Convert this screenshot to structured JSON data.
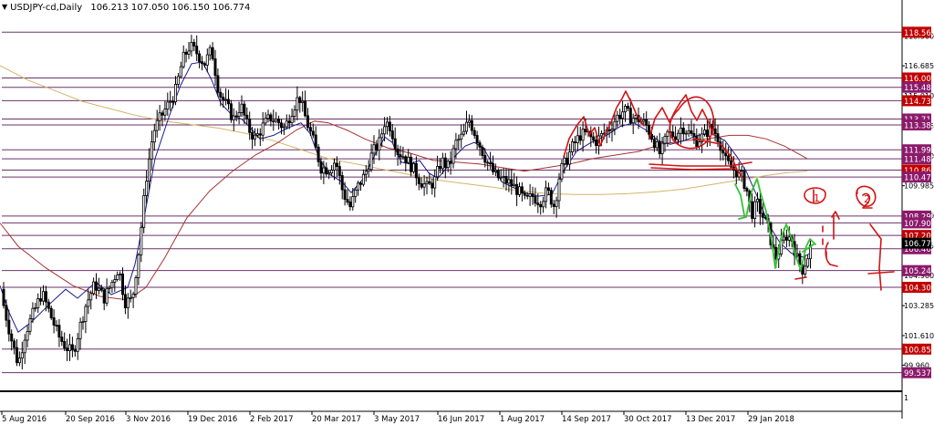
{
  "header": {
    "symbol": "USDJPY-cd,Daily",
    "open": "106.213",
    "high": "107.050",
    "low": "106.150",
    "close": "106.774"
  },
  "chart_data": {
    "type": "candlestick",
    "ylim": [
      98.5,
      119.7
    ],
    "y_ticks": [
      "118.360",
      "116.685",
      "115.010",
      "113.335",
      "111.660",
      "109.985",
      "108.310",
      "106.635",
      "104.960",
      "103.285",
      "101.610",
      "99.960"
    ],
    "x_ticks": [
      "5 Aug 2016",
      "20 Sep 2016",
      "3 Nov 2016",
      "19 Dec 2016",
      "2 Feb 2017",
      "20 Mar 2017",
      "3 May 2017",
      "16 Jun 2017",
      "1 Aug 2017",
      "14 Sep 2017",
      "30 Oct 2017",
      "13 Dec 2017",
      "29 Jan 2018"
    ],
    "price_levels": [
      {
        "label": "118.563",
        "value": 118.563,
        "color": "#c00000"
      },
      {
        "label": "116.006",
        "value": 116.006,
        "color": "#c00000"
      },
      {
        "label": "115.485",
        "value": 115.485,
        "color": "#8b1a6b"
      },
      {
        "label": "114.735",
        "value": 114.735,
        "color": "#c00000"
      },
      {
        "label": "113.714",
        "value": 113.714,
        "color": "#8b1a6b"
      },
      {
        "label": "113.382",
        "value": 113.382,
        "color": "#8b1a6b"
      },
      {
        "label": "111.993",
        "value": 111.993,
        "color": "#8b1a6b"
      },
      {
        "label": "111.489",
        "value": 111.489,
        "color": "#8b1a6b"
      },
      {
        "label": "110.861",
        "value": 110.861,
        "color": "#c00000"
      },
      {
        "label": "110.472",
        "value": 110.472,
        "color": "#8b1a6b"
      },
      {
        "label": "108.290",
        "value": 108.29,
        "color": "#8b1a6b"
      },
      {
        "label": "107.908",
        "value": 107.908,
        "color": "#8b1a6b"
      },
      {
        "label": "107.207",
        "value": 107.207,
        "color": "#c00000"
      },
      {
        "label": "106.463",
        "value": 106.463,
        "color": "#8b1a6b"
      },
      {
        "label": "105.244",
        "value": 105.244,
        "color": "#8b1a6b"
      },
      {
        "label": "104.307",
        "value": 104.307,
        "color": "#c00000"
      },
      {
        "label": "100.855",
        "value": 100.855,
        "color": "#c00000"
      },
      {
        "label": "99.537",
        "value": 99.537,
        "color": "#8b1a6b"
      }
    ],
    "current_price": {
      "label": "106.774",
      "value": 106.774,
      "color": "#000000"
    },
    "ma_fast": [
      [
        0,
        104.4
      ],
      [
        10,
        102.9
      ],
      [
        20,
        101.8
      ],
      [
        35,
        102.4
      ],
      [
        55,
        103.4
      ],
      [
        72,
        104.2
      ],
      [
        85,
        103.7
      ],
      [
        105,
        104.6
      ],
      [
        122,
        103.9
      ],
      [
        140,
        104.3
      ],
      [
        148,
        105.6
      ],
      [
        158,
        108.2
      ],
      [
        170,
        111.5
      ],
      [
        185,
        113.8
      ],
      [
        198,
        115.6
      ],
      [
        210,
        116.8
      ],
      [
        222,
        116.9
      ],
      [
        232,
        115.9
      ],
      [
        242,
        114.6
      ],
      [
        255,
        113.9
      ],
      [
        265,
        113.7
      ],
      [
        275,
        113.2
      ],
      [
        285,
        112.6
      ],
      [
        300,
        112.8
      ],
      [
        315,
        113.2
      ],
      [
        330,
        113.5
      ],
      [
        340,
        112.9
      ],
      [
        350,
        111.5
      ],
      [
        362,
        110.6
      ],
      [
        375,
        110.2
      ],
      [
        385,
        109.6
      ],
      [
        397,
        110.3
      ],
      [
        410,
        111.6
      ],
      [
        422,
        112.7
      ],
      [
        430,
        112.4
      ],
      [
        440,
        111.3
      ],
      [
        450,
        111.2
      ],
      [
        460,
        111.4
      ],
      [
        470,
        110.7
      ],
      [
        480,
        110.4
      ],
      [
        490,
        111.0
      ],
      [
        500,
        111.7
      ],
      [
        510,
        112.2
      ],
      [
        520,
        112.4
      ],
      [
        530,
        112.1
      ],
      [
        540,
        111.2
      ],
      [
        550,
        110.2
      ],
      [
        562,
        109.9
      ],
      [
        575,
        109.6
      ],
      [
        590,
        109.4
      ],
      [
        605,
        109.5
      ],
      [
        618,
        110.8
      ],
      [
        632,
        111.9
      ],
      [
        648,
        112.4
      ],
      [
        665,
        112.8
      ],
      [
        680,
        113.3
      ],
      [
        695,
        113.5
      ],
      [
        708,
        113.1
      ],
      [
        722,
        112.5
      ],
      [
        735,
        112.3
      ],
      [
        750,
        112.5
      ],
      [
        765,
        112.8
      ],
      [
        780,
        112.9
      ],
      [
        795,
        112.5
      ],
      [
        808,
        111.6
      ],
      [
        818,
        110.8
      ],
      [
        830,
        109.4
      ],
      [
        843,
        107.8
      ],
      [
        855,
        106.8
      ],
      [
        868,
        106.2
      ],
      [
        880,
        106.0
      ],
      [
        888,
        106.2
      ]
    ],
    "ma_mid": [
      [
        0,
        107.9
      ],
      [
        20,
        106.6
      ],
      [
        50,
        105.4
      ],
      [
        80,
        104.4
      ],
      [
        110,
        103.8
      ],
      [
        140,
        103.6
      ],
      [
        160,
        104.3
      ],
      [
        180,
        105.9
      ],
      [
        205,
        108.2
      ],
      [
        230,
        109.7
      ],
      [
        255,
        110.8
      ],
      [
        280,
        111.7
      ],
      [
        305,
        112.4
      ],
      [
        325,
        113.1
      ],
      [
        345,
        113.6
      ],
      [
        360,
        113.5
      ],
      [
        380,
        113.1
      ],
      [
        400,
        112.6
      ],
      [
        425,
        112.1
      ],
      [
        450,
        111.8
      ],
      [
        475,
        111.4
      ],
      [
        500,
        111.3
      ],
      [
        525,
        111.2
      ],
      [
        550,
        111.0
      ],
      [
        575,
        110.8
      ],
      [
        600,
        111.0
      ],
      [
        625,
        111.2
      ],
      [
        650,
        111.5
      ],
      [
        675,
        111.7
      ],
      [
        700,
        111.9
      ],
      [
        725,
        112.3
      ],
      [
        750,
        112.5
      ],
      [
        775,
        112.6
      ],
      [
        800,
        112.8
      ],
      [
        820,
        112.8
      ],
      [
        840,
        112.6
      ],
      [
        860,
        112.2
      ],
      [
        885,
        111.5
      ]
    ],
    "ma_slow": [
      [
        0,
        116.7
      ],
      [
        30,
        115.9
      ],
      [
        60,
        115.3
      ],
      [
        90,
        114.7
      ],
      [
        120,
        114.3
      ],
      [
        150,
        113.9
      ],
      [
        180,
        113.6
      ],
      [
        210,
        113.4
      ],
      [
        240,
        113.2
      ],
      [
        270,
        112.9
      ],
      [
        300,
        112.5
      ],
      [
        330,
        112.0
      ],
      [
        360,
        111.5
      ],
      [
        390,
        111.2
      ],
      [
        420,
        110.9
      ],
      [
        450,
        110.6
      ],
      [
        480,
        110.3
      ],
      [
        510,
        110.1
      ],
      [
        540,
        109.9
      ],
      [
        570,
        109.7
      ],
      [
        600,
        109.55
      ],
      [
        630,
        109.5
      ],
      [
        660,
        109.5
      ],
      [
        690,
        109.55
      ],
      [
        720,
        109.65
      ],
      [
        750,
        109.8
      ],
      [
        780,
        110.05
      ],
      [
        810,
        110.3
      ],
      [
        840,
        110.55
      ],
      [
        860,
        110.7
      ],
      [
        885,
        110.8
      ]
    ],
    "candle_path": [
      [
        0,
        104.2
      ],
      [
        12,
        101.5
      ],
      [
        20,
        100.0
      ],
      [
        28,
        101.8
      ],
      [
        36,
        102.8
      ],
      [
        46,
        104.0
      ],
      [
        55,
        102.8
      ],
      [
        64,
        101.6
      ],
      [
        72,
        101.0
      ],
      [
        80,
        100.6
      ],
      [
        86,
        101.8
      ],
      [
        94,
        103.3
      ],
      [
        104,
        104.5
      ],
      [
        114,
        103.7
      ],
      [
        122,
        104.5
      ],
      [
        130,
        105.4
      ],
      [
        137,
        103.5
      ],
      [
        145,
        103.6
      ],
      [
        152,
        106.3
      ],
      [
        160,
        110.3
      ],
      [
        168,
        113.0
      ],
      [
        176,
        113.8
      ],
      [
        184,
        114.5
      ],
      [
        192,
        115.2
      ],
      [
        200,
        117.0
      ],
      [
        208,
        117.8
      ],
      [
        216,
        117.4
      ],
      [
        224,
        116.8
      ],
      [
        232,
        117.6
      ],
      [
        240,
        115.2
      ],
      [
        248,
        114.5
      ],
      [
        256,
        113.7
      ],
      [
        264,
        114.5
      ],
      [
        272,
        113.2
      ],
      [
        280,
        112.6
      ],
      [
        288,
        113.3
      ],
      [
        296,
        113.8
      ],
      [
        304,
        113.6
      ],
      [
        312,
        113.2
      ],
      [
        320,
        114.2
      ],
      [
        328,
        115.0
      ],
      [
        336,
        113.6
      ],
      [
        344,
        112.4
      ],
      [
        352,
        111.0
      ],
      [
        360,
        110.9
      ],
      [
        368,
        111.4
      ],
      [
        376,
        109.6
      ],
      [
        384,
        108.8
      ],
      [
        392,
        109.9
      ],
      [
        400,
        110.6
      ],
      [
        408,
        111.8
      ],
      [
        416,
        112.4
      ],
      [
        422,
        113.6
      ],
      [
        428,
        113.3
      ],
      [
        436,
        111.9
      ],
      [
        444,
        111.6
      ],
      [
        452,
        111.0
      ],
      [
        460,
        110.3
      ],
      [
        468,
        109.9
      ],
      [
        476,
        110.2
      ],
      [
        484,
        111.4
      ],
      [
        492,
        111.0
      ],
      [
        500,
        112.4
      ],
      [
        508,
        112.8
      ],
      [
        514,
        113.7
      ],
      [
        520,
        113.0
      ],
      [
        528,
        112.0
      ],
      [
        536,
        111.1
      ],
      [
        544,
        110.5
      ],
      [
        552,
        110.3
      ],
      [
        560,
        110.1
      ],
      [
        568,
        109.7
      ],
      [
        576,
        109.1
      ],
      [
        584,
        109.4
      ],
      [
        592,
        109.1
      ],
      [
        600,
        109.7
      ],
      [
        608,
        108.8
      ],
      [
        614,
        110.8
      ],
      [
        620,
        111.3
      ],
      [
        628,
        112.2
      ],
      [
        636,
        112.8
      ],
      [
        644,
        112.9
      ],
      [
        652,
        112.4
      ],
      [
        660,
        112.8
      ],
      [
        668,
        113.2
      ],
      [
        676,
        113.8
      ],
      [
        684,
        114.2
      ],
      [
        692,
        113.8
      ],
      [
        700,
        113.7
      ],
      [
        708,
        113.4
      ],
      [
        716,
        112.6
      ],
      [
        724,
        111.7
      ],
      [
        732,
        112.9
      ],
      [
        740,
        112.8
      ],
      [
        748,
        113.3
      ],
      [
        756,
        112.9
      ],
      [
        764,
        112.5
      ],
      [
        772,
        112.8
      ],
      [
        780,
        113.3
      ],
      [
        788,
        112.6
      ],
      [
        796,
        111.3
      ],
      [
        804,
        110.9
      ],
      [
        812,
        110.6
      ],
      [
        818,
        109.9
      ],
      [
        824,
        108.4
      ],
      [
        830,
        109.0
      ],
      [
        836,
        108.3
      ],
      [
        842,
        107.6
      ],
      [
        850,
        105.9
      ],
      [
        856,
        106.6
      ],
      [
        862,
        107.2
      ],
      [
        868,
        107.0
      ],
      [
        874,
        105.9
      ],
      [
        880,
        105.3
      ],
      [
        886,
        106.1
      ],
      [
        890,
        106.8
      ]
    ]
  },
  "annotations": {
    "labels": [
      "1",
      "2"
    ],
    "colors": {
      "red": "#d01414",
      "green": "#35c235"
    }
  },
  "colors": {
    "ma_fast": "#1b1b8f",
    "ma_mid": "#a83232",
    "ma_slow": "#d4b36a",
    "price_level": "#8b1a6b",
    "grid_line": "#5a1e5a"
  }
}
